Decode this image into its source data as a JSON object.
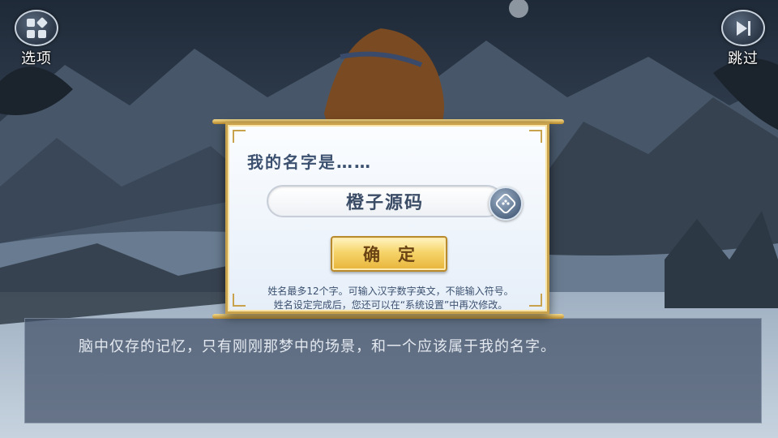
{
  "top_bar": {
    "options_label": "选项",
    "options_icon": "menu-grid-icon",
    "skip_label": "跳过",
    "skip_icon": "skip-forward-icon"
  },
  "name_dialog": {
    "title": "我的名字是……",
    "name_value": "橙子源码",
    "random_icon": "dice-icon",
    "confirm_label": "确定",
    "hint_line1": "姓名最多12个字。可输入汉字数字英文，不能输入符号。",
    "hint_line2": "姓名设定完成后，您还可以在“系统设置”中再次修改。"
  },
  "dialogue": {
    "text": "脑中仅存的记忆，只有刚刚那梦中的场景，和一个应该属于我的名字。"
  },
  "colors": {
    "frame_gold": "#c9a24e",
    "dialog_bg": "#eef4fb",
    "title_text": "#3c5170",
    "button_gold": "#f6d46a",
    "dialogue_box": "#425068"
  }
}
